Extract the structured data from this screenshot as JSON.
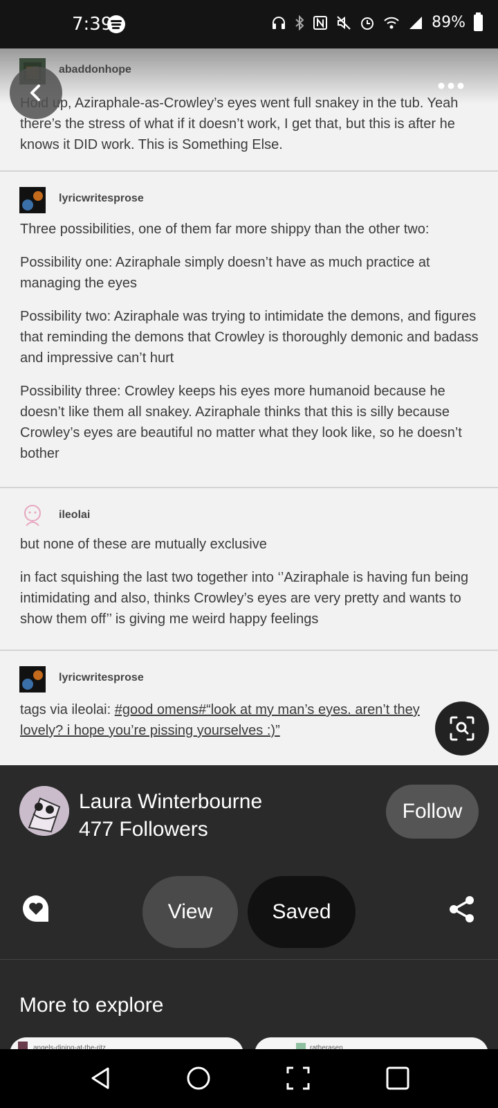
{
  "status_bar": {
    "time": "7:39",
    "battery": "89%"
  },
  "posts": [
    {
      "author": "abaddonhope",
      "paragraphs": [
        "Hold up, Aziraphale-as-Crowley’s eyes went full snakey in the tub. Yeah there’s the stress of what if it doesn’t work, I get that, but this is after he knows it DID work. This is Something Else."
      ]
    },
    {
      "author": "lyricwritesprose",
      "paragraphs": [
        "Three possibilities, one of them far more shippy than the other two:",
        "Possibility one: Aziraphale simply doesn’t have as much practice at managing the eyes",
        "Possibility two: Aziraphale was trying to intimidate the demons, and figures that reminding the demons that Crowley is thoroughly demonic and badass and impressive can’t hurt",
        "Possibility three: Crowley keeps his eyes more humanoid because he doesn’t like them all snakey.  Aziraphale thinks that this is silly because Crowley’s eyes are beautiful no matter what they look like, so he doesn’t bother"
      ]
    },
    {
      "author": "ileolai",
      "paragraphs": [
        "but none of these are mutually exclusive",
        "in fact squishing the last two together into ‘’Aziraphale is having fun being intimidating and also, thinks Crowley’s eyes are very pretty and wants to show them off’’ is giving me weird happy feelings"
      ]
    },
    {
      "author": "lyricwritesprose",
      "tags_prefix": "tags via ileolai: ",
      "tags_text": "#good omens#“look at my man’s eyes. aren’t they lovely? i hope you’re pissing yourselves :)”"
    }
  ],
  "creator": {
    "name": "Laura Winterbourne",
    "followers": "477 Followers",
    "follow_label": "Follow"
  },
  "actions": {
    "view_label": "View",
    "saved_label": "Saved"
  },
  "explore": {
    "title": "More to explore",
    "cards": [
      "angels-dining-at-the-ritz",
      "ratherasen"
    ]
  },
  "icons": [
    "back-arrow-icon",
    "more-options-icon",
    "visual-search-icon",
    "comment-icon",
    "share-icon",
    "nav-back-icon",
    "nav-home-icon",
    "nav-screenshot-icon",
    "nav-recents-icon"
  ]
}
